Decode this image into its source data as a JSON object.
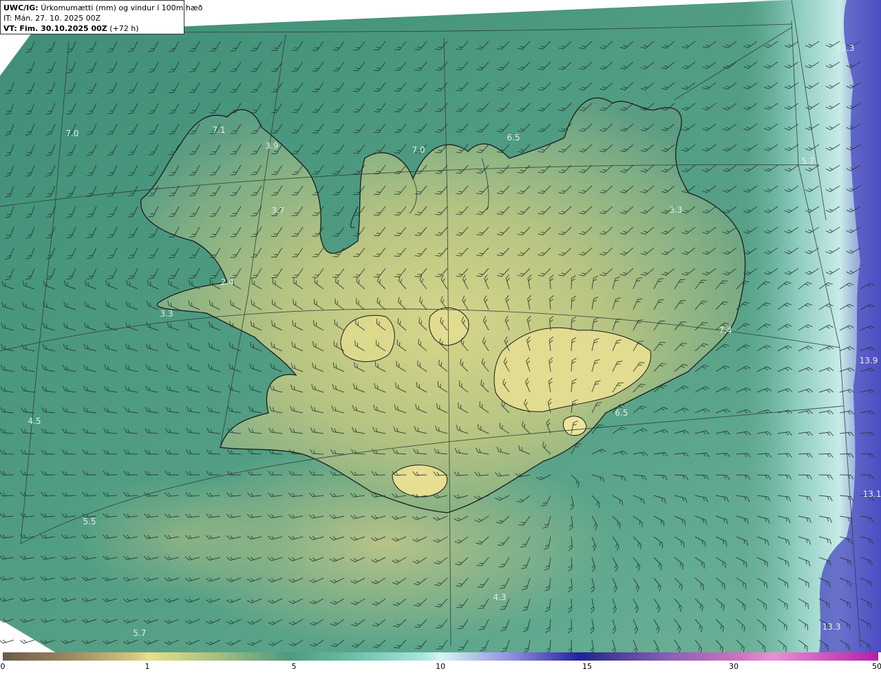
{
  "header": {
    "model": "UWC/IG:",
    "title": "Úrkomumætti (mm) og vindur í 100m hæð",
    "issue_time": "IT: Mán. 27. 10. 2025 00Z",
    "valid_prefix": "VT:",
    "valid_time": "Fim. 30.10.2025 00Z",
    "lead": "(+72 h)"
  },
  "colorbar": {
    "ticks": [
      {
        "label": "0",
        "value": 0
      },
      {
        "label": "1",
        "value": 1
      },
      {
        "label": "5",
        "value": 5
      },
      {
        "label": "10",
        "value": 10
      },
      {
        "label": "15",
        "value": 15
      },
      {
        "label": "30",
        "value": 30
      },
      {
        "label": "50",
        "value": 50
      }
    ]
  },
  "map_values": [
    {
      "label": "12.3",
      "value": 12.3
    },
    {
      "label": "7.0",
      "value": 7.0
    },
    {
      "label": "7.1",
      "value": 7.1
    },
    {
      "label": "3.9",
      "value": 3.9
    },
    {
      "label": "7.0",
      "value": 7.0
    },
    {
      "label": "6.5",
      "value": 6.5
    },
    {
      "label": "5.7",
      "value": 5.7
    },
    {
      "label": "3.7",
      "value": 3.7
    },
    {
      "label": "3.3",
      "value": 3.3
    },
    {
      "label": "2.4",
      "value": 2.4
    },
    {
      "label": "3.3",
      "value": 3.3
    },
    {
      "label": "7.4",
      "value": 7.4
    },
    {
      "label": "13.9",
      "value": 13.9
    },
    {
      "label": "4.5",
      "value": 4.5
    },
    {
      "label": "6.5",
      "value": 6.5
    },
    {
      "label": "13.1",
      "value": 13.1
    },
    {
      "label": "5.5",
      "value": 5.5
    },
    {
      "label": "4.3",
      "value": 4.3
    },
    {
      "label": "5.7",
      "value": 5.7
    },
    {
      "label": "13.3",
      "value": 13.3
    }
  ],
  "colors": {
    "sea": "#4e9a80",
    "land_high": "#d8d68a",
    "heavy_precip": "#3a3ab8",
    "coastline": "#1a1a1a",
    "grid": "#2b3a35"
  }
}
